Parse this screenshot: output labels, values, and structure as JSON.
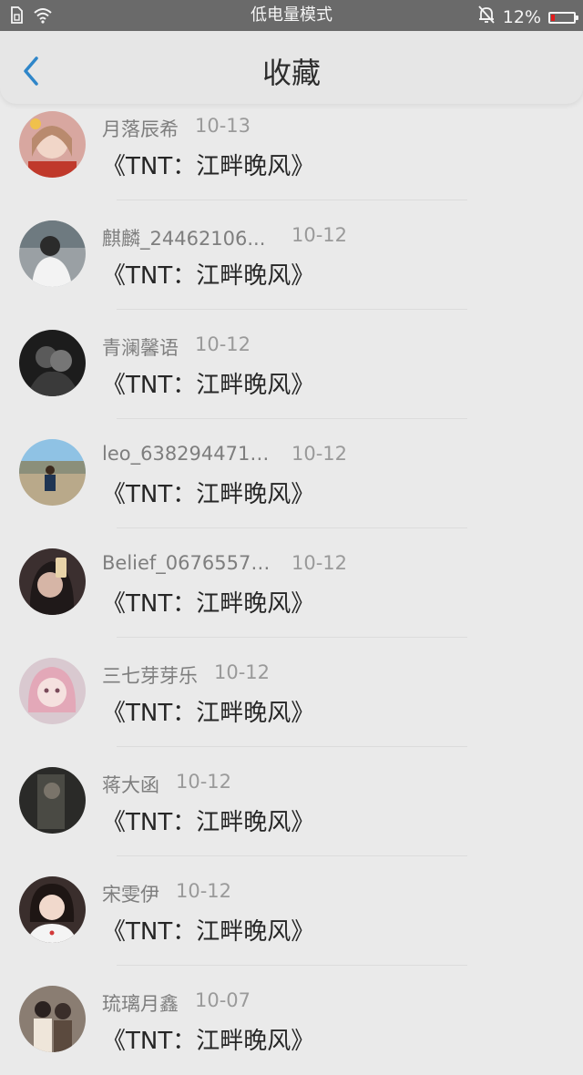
{
  "status_bar": {
    "center_text": "低电量模式",
    "battery_text": "12%",
    "battery_color": "#e31b1b"
  },
  "nav": {
    "title": "收藏",
    "accent_color": "#2f86c9"
  },
  "items": [
    {
      "user": "月落辰希",
      "date": "10-13",
      "title": "《TNT：江畔晚风》"
    },
    {
      "user": "麒麟_24462106...",
      "date": "10-12",
      "title": "《TNT：江畔晚风》"
    },
    {
      "user": "青澜馨语",
      "date": "10-12",
      "title": "《TNT：江畔晚风》"
    },
    {
      "user": "leo_6382944719...",
      "date": "10-12",
      "title": "《TNT：江畔晚风》"
    },
    {
      "user": "Belief_06765577...",
      "date": "10-12",
      "title": "《TNT：江畔晚风》"
    },
    {
      "user": "三七芽芽乐",
      "date": "10-12",
      "title": "《TNT：江畔晚风》"
    },
    {
      "user": "蒋大函",
      "date": "10-12",
      "title": "《TNT：江畔晚风》"
    },
    {
      "user": "宋雯伊",
      "date": "10-12",
      "title": "《TNT：江畔晚风》"
    },
    {
      "user": "琉璃月鑫",
      "date": "10-07",
      "title": "《TNT：江畔晚风》"
    }
  ]
}
